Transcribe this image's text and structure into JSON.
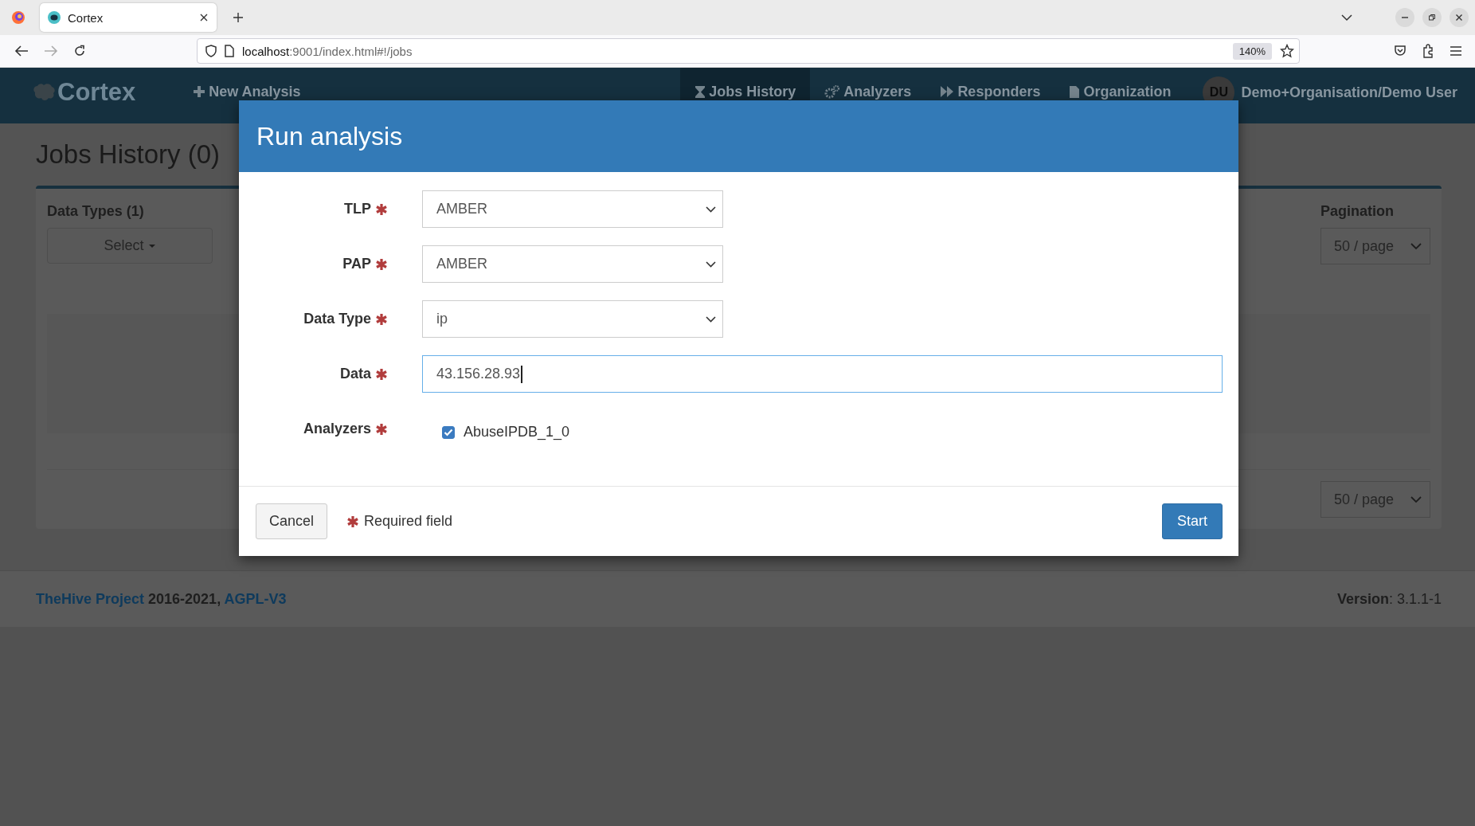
{
  "browser": {
    "tab_title": "Cortex",
    "url_host": "localhost",
    "url_rest": ":9001/index.html#!/jobs",
    "zoom": "140%"
  },
  "navbar": {
    "brand": "Cortex",
    "new_analysis": "New Analysis",
    "items": [
      {
        "kind": "hourglass",
        "label": "Jobs History",
        "selected": true
      },
      {
        "kind": "gears",
        "label": "Analyzers",
        "selected": false
      },
      {
        "kind": "forward",
        "label": "Responders",
        "selected": false
      },
      {
        "kind": "file",
        "label": "Organization",
        "selected": false
      }
    ],
    "user": {
      "initials": "DU",
      "name": "Demo+Organisation/Demo User"
    }
  },
  "page": {
    "title": "Jobs History (0)",
    "data_types_label": "Data Types (1)",
    "select_button": "Select",
    "pagination_label": "Pagination",
    "pagination_top": "50 / page",
    "pagination_bottom": "50 / page"
  },
  "modal": {
    "title": "Run analysis",
    "fields": [
      {
        "kind": "select",
        "label": "TLP",
        "required": true,
        "value": "AMBER"
      },
      {
        "kind": "select",
        "label": "PAP",
        "required": true,
        "value": "AMBER"
      },
      {
        "kind": "select",
        "label": "Data Type",
        "required": true,
        "value": "ip"
      },
      {
        "kind": "input",
        "label": "Data",
        "required": true,
        "value": "43.156.28.93"
      },
      {
        "kind": "checkboxes",
        "label": "Analyzers",
        "required": true,
        "options": [
          {
            "label": "AbuseIPDB_1_0",
            "checked": true
          }
        ]
      }
    ],
    "cancel": "Cancel",
    "required_note": "Required field",
    "start": "Start"
  },
  "footer": {
    "project_link": "TheHive Project",
    "years": "2016-2021,",
    "license_link": "AGPL-V3",
    "version_label": "Version",
    "version": ": 3.1.1-1"
  }
}
